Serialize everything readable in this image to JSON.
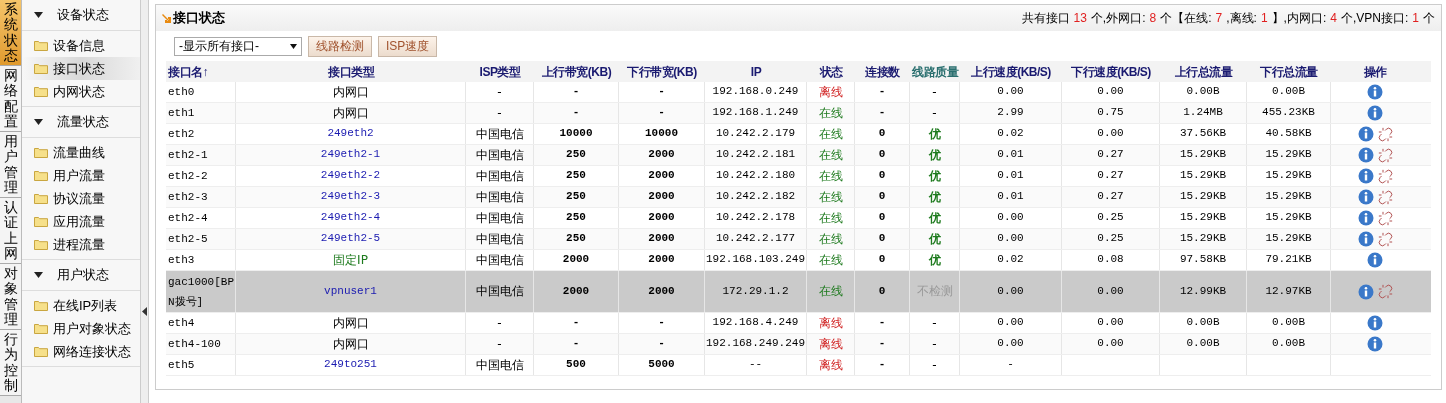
{
  "nav_tabs": [
    {
      "label": "系统状态",
      "selected": true
    },
    {
      "label": "网络配置",
      "selected": false
    },
    {
      "label": "用户管理",
      "selected": false
    },
    {
      "label": "认证上网",
      "selected": false
    },
    {
      "label": "对象管理",
      "selected": false
    },
    {
      "label": "行为控制",
      "selected": false
    }
  ],
  "sidebar": {
    "groups": [
      {
        "title": "设备状态",
        "expanded": true,
        "items": [
          {
            "label": "设备信息",
            "selected": false
          },
          {
            "label": "接口状态",
            "selected": true
          },
          {
            "label": "内网状态",
            "selected": false
          }
        ]
      },
      {
        "title": "流量状态",
        "expanded": true,
        "items": [
          {
            "label": "流量曲线",
            "selected": false
          },
          {
            "label": "用户流量",
            "selected": false
          },
          {
            "label": "协议流量",
            "selected": false
          },
          {
            "label": "应用流量",
            "selected": false
          },
          {
            "label": "进程流量",
            "selected": false
          }
        ]
      },
      {
        "title": "用户状态",
        "expanded": true,
        "items": [
          {
            "label": "在线IP列表",
            "selected": false
          },
          {
            "label": "用户对象状态",
            "selected": false
          },
          {
            "label": "网络连接状态",
            "selected": false
          }
        ]
      }
    ]
  },
  "panel": {
    "title": "接口状态",
    "summary": [
      {
        "kind": "label",
        "text": "共有接口"
      },
      {
        "kind": "count",
        "text": "13"
      },
      {
        "kind": "label",
        "text": "个,外网口:"
      },
      {
        "kind": "count",
        "text": "8"
      },
      {
        "kind": "label",
        "text": "个【在线:"
      },
      {
        "kind": "count",
        "text": "7"
      },
      {
        "kind": "label",
        "text": ",离线:"
      },
      {
        "kind": "count",
        "text": "1"
      },
      {
        "kind": "label",
        "text": "】,内网口:"
      },
      {
        "kind": "count",
        "text": "4"
      },
      {
        "kind": "label",
        "text": "个,VPN接口:"
      },
      {
        "kind": "count",
        "text": "1"
      },
      {
        "kind": "label",
        "text": "个"
      }
    ],
    "filter": {
      "value": "-显示所有接口-"
    },
    "buttons": [
      "线路检测",
      "ISP速度"
    ],
    "table": {
      "columns": [
        "接口名↑",
        "接口类型",
        "ISP类型",
        "上行带宽(KB)",
        "下行带宽(KB)",
        "IP",
        "状态",
        "连接数",
        "线路质量",
        "上行速度(KB/S)",
        "下行速度(KB/S)",
        "上行总流量",
        "下行总流量",
        "操作"
      ],
      "rows": [
        {
          "selected": false,
          "name": "eth0",
          "type": {
            "kind": "internal",
            "text": "内网口"
          },
          "isp": "-",
          "up_bw": "-",
          "down_bw": "-",
          "ip": "192.168.0.249",
          "status": {
            "online": false,
            "text": "离线"
          },
          "connections": "-",
          "quality": {
            "kind": "none",
            "text": "-"
          },
          "up_speed": "0.00",
          "down_speed": "0.00",
          "up_total": "0.00B",
          "down_total": "0.00B",
          "info_action": true,
          "unlink_action": false
        },
        {
          "selected": false,
          "name": "eth1",
          "type": {
            "kind": "internal",
            "text": "内网口"
          },
          "isp": "-",
          "up_bw": "-",
          "down_bw": "-",
          "ip": "192.168.1.249",
          "status": {
            "online": true,
            "text": "在线"
          },
          "connections": "-",
          "quality": {
            "kind": "none",
            "text": "-"
          },
          "up_speed": "2.99",
          "down_speed": "0.75",
          "up_total": "1.24MB",
          "down_total": "455.23KB",
          "info_action": true,
          "unlink_action": false
        },
        {
          "selected": false,
          "name": "eth2",
          "type": {
            "kind": "link",
            "text": "249eth2"
          },
          "isp": "中国电信",
          "up_bw": "10000",
          "down_bw": "10000",
          "ip": "10.242.2.179",
          "status": {
            "online": true,
            "text": "在线"
          },
          "connections": "0",
          "quality": {
            "kind": "good",
            "text": "优"
          },
          "up_speed": "0.02",
          "down_speed": "0.00",
          "up_total": "37.56KB",
          "down_total": "40.58KB",
          "info_action": true,
          "unlink_action": true
        },
        {
          "selected": false,
          "name": "eth2-1",
          "type": {
            "kind": "link",
            "text": "249eth2-1"
          },
          "isp": "中国电信",
          "up_bw": "250",
          "down_bw": "2000",
          "ip": "10.242.2.181",
          "status": {
            "online": true,
            "text": "在线"
          },
          "connections": "0",
          "quality": {
            "kind": "good",
            "text": "优"
          },
          "up_speed": "0.01",
          "down_speed": "0.27",
          "up_total": "15.29KB",
          "down_total": "15.29KB",
          "info_action": true,
          "unlink_action": true
        },
        {
          "selected": false,
          "name": "eth2-2",
          "type": {
            "kind": "link",
            "text": "249eth2-2"
          },
          "isp": "中国电信",
          "up_bw": "250",
          "down_bw": "2000",
          "ip": "10.242.2.180",
          "status": {
            "online": true,
            "text": "在线"
          },
          "connections": "0",
          "quality": {
            "kind": "good",
            "text": "优"
          },
          "up_speed": "0.01",
          "down_speed": "0.27",
          "up_total": "15.29KB",
          "down_total": "15.29KB",
          "info_action": true,
          "unlink_action": true
        },
        {
          "selected": false,
          "name": "eth2-3",
          "type": {
            "kind": "link",
            "text": "249eth2-3"
          },
          "isp": "中国电信",
          "up_bw": "250",
          "down_bw": "2000",
          "ip": "10.242.2.182",
          "status": {
            "online": true,
            "text": "在线"
          },
          "connections": "0",
          "quality": {
            "kind": "good",
            "text": "优"
          },
          "up_speed": "0.01",
          "down_speed": "0.27",
          "up_total": "15.29KB",
          "down_total": "15.29KB",
          "info_action": true,
          "unlink_action": true
        },
        {
          "selected": false,
          "name": "eth2-4",
          "type": {
            "kind": "link",
            "text": "249eth2-4"
          },
          "isp": "中国电信",
          "up_bw": "250",
          "down_bw": "2000",
          "ip": "10.242.2.178",
          "status": {
            "online": true,
            "text": "在线"
          },
          "connections": "0",
          "quality": {
            "kind": "good",
            "text": "优"
          },
          "up_speed": "0.00",
          "down_speed": "0.25",
          "up_total": "15.29KB",
          "down_total": "15.29KB",
          "info_action": true,
          "unlink_action": true
        },
        {
          "selected": false,
          "name": "eth2-5",
          "type": {
            "kind": "link",
            "text": "249eth2-5"
          },
          "isp": "中国电信",
          "up_bw": "250",
          "down_bw": "2000",
          "ip": "10.242.2.177",
          "status": {
            "online": true,
            "text": "在线"
          },
          "connections": "0",
          "quality": {
            "kind": "good",
            "text": "优"
          },
          "up_speed": "0.00",
          "down_speed": "0.25",
          "up_total": "15.29KB",
          "down_total": "15.29KB",
          "info_action": true,
          "unlink_action": true
        },
        {
          "selected": false,
          "name": "eth3",
          "type": {
            "kind": "static",
            "text": "固定IP"
          },
          "isp": "中国电信",
          "up_bw": "2000",
          "down_bw": "2000",
          "ip": "192.168.103.249",
          "status": {
            "online": true,
            "text": "在线"
          },
          "connections": "0",
          "quality": {
            "kind": "good",
            "text": "优"
          },
          "up_speed": "0.02",
          "down_speed": "0.08",
          "up_total": "97.58KB",
          "down_total": "79.21KB",
          "info_action": true,
          "unlink_action": false
        },
        {
          "selected": true,
          "name": "gac1000[BPN拨号]",
          "type": {
            "kind": "link",
            "text": "vpnuser1"
          },
          "isp": "中国电信",
          "up_bw": "2000",
          "down_bw": "2000",
          "ip": "172.29.1.2",
          "status": {
            "online": true,
            "text": "在线"
          },
          "connections": "0",
          "quality": {
            "kind": "skip",
            "text": "不检测"
          },
          "up_speed": "0.00",
          "down_speed": "0.00",
          "up_total": "12.99KB",
          "down_total": "12.97KB",
          "info_action": true,
          "unlink_action": true
        },
        {
          "selected": false,
          "name": "eth4",
          "type": {
            "kind": "internal",
            "text": "内网口"
          },
          "isp": "-",
          "up_bw": "-",
          "down_bw": "-",
          "ip": "192.168.4.249",
          "status": {
            "online": false,
            "text": "离线"
          },
          "connections": "-",
          "quality": {
            "kind": "none",
            "text": "-"
          },
          "up_speed": "0.00",
          "down_speed": "0.00",
          "up_total": "0.00B",
          "down_total": "0.00B",
          "info_action": true,
          "unlink_action": false
        },
        {
          "selected": false,
          "name": "eth4-100",
          "type": {
            "kind": "internal",
            "text": "内网口"
          },
          "isp": "-",
          "up_bw": "-",
          "down_bw": "-",
          "ip": "192.168.249.249",
          "status": {
            "online": false,
            "text": "离线"
          },
          "connections": "-",
          "quality": {
            "kind": "none",
            "text": "-"
          },
          "up_speed": "0.00",
          "down_speed": "0.00",
          "up_total": "0.00B",
          "down_total": "0.00B",
          "info_action": true,
          "unlink_action": false
        },
        {
          "selected": false,
          "name": "eth5",
          "type": {
            "kind": "link",
            "text": "249to251"
          },
          "isp": "中国电信",
          "up_bw": "500",
          "down_bw": "5000",
          "ip": "--",
          "status": {
            "online": false,
            "text": "离线"
          },
          "connections": "-",
          "quality": {
            "kind": "none",
            "text": "-"
          },
          "up_speed": "-"
        }
      ]
    }
  }
}
